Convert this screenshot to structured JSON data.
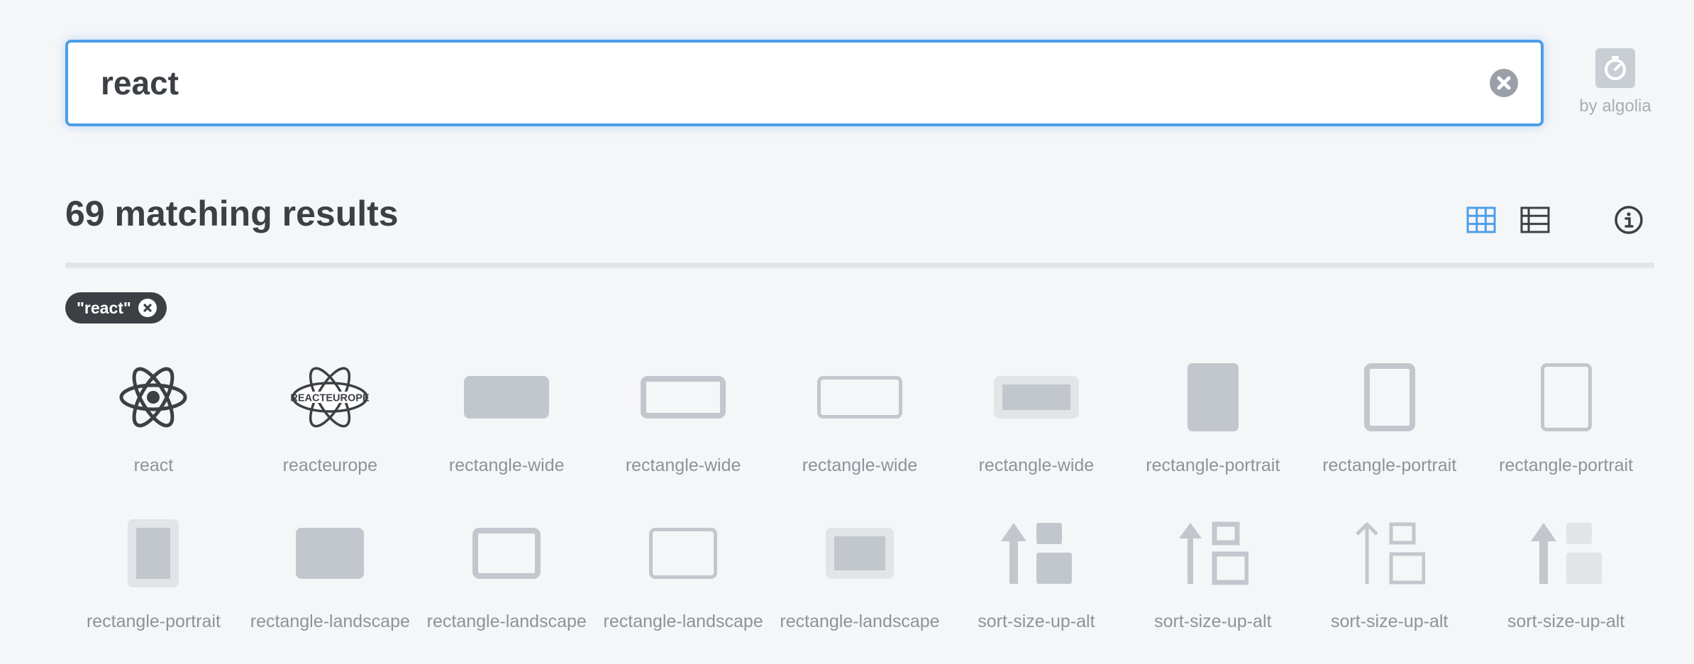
{
  "search": {
    "value": "react",
    "placeholder": ""
  },
  "algolia": {
    "label": "by algolia",
    "icon": "stopwatch-icon"
  },
  "results": {
    "count_text": "69 matching results",
    "view_options": [
      "grid-view-icon",
      "list-view-icon"
    ],
    "active_view": "grid",
    "info_icon": "info-icon"
  },
  "filters": [
    {
      "label": "\"react\""
    }
  ],
  "icons": [
    {
      "name": "react",
      "glyph": "react"
    },
    {
      "name": "reacteurope",
      "glyph": "reacteurope"
    },
    {
      "name": "rectangle-wide",
      "glyph": "rw-solid"
    },
    {
      "name": "rectangle-wide",
      "glyph": "rw-regular"
    },
    {
      "name": "rectangle-wide",
      "glyph": "rw-light"
    },
    {
      "name": "rectangle-wide",
      "glyph": "rw-duotone"
    },
    {
      "name": "rectangle-portrait",
      "glyph": "rp-solid"
    },
    {
      "name": "rectangle-portrait",
      "glyph": "rp-regular"
    },
    {
      "name": "rectangle-portrait",
      "glyph": "rp-light"
    },
    {
      "name": "rectangle-portrait",
      "glyph": "rp-duotone"
    },
    {
      "name": "rectangle-landscape",
      "glyph": "rl-solid"
    },
    {
      "name": "rectangle-landscape",
      "glyph": "rl-regular"
    },
    {
      "name": "rectangle-landscape",
      "glyph": "rl-light"
    },
    {
      "name": "rectangle-landscape",
      "glyph": "rl-duotone"
    },
    {
      "name": "sort-size-up-alt",
      "glyph": "ss-solid"
    },
    {
      "name": "sort-size-up-alt",
      "glyph": "ss-regular"
    },
    {
      "name": "sort-size-up-alt",
      "glyph": "ss-light"
    },
    {
      "name": "sort-size-up-alt",
      "glyph": "ss-duotone"
    }
  ],
  "colors": {
    "accent": "#4d9ee8",
    "text": "#3c4045",
    "muted": "#8d939b",
    "icon_gray": "#c2c7cd",
    "icon_light": "#e2e4e7",
    "background": "#f5f6f8"
  }
}
